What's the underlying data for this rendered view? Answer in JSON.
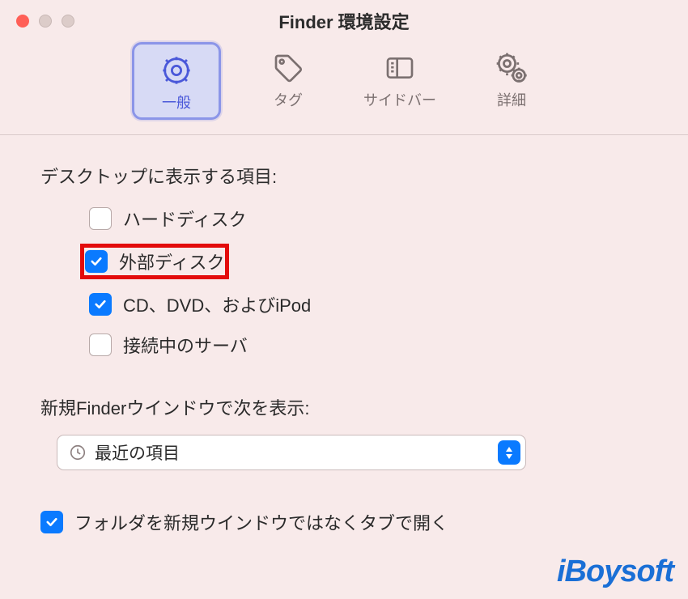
{
  "window": {
    "title": "Finder 環境設定"
  },
  "toolbar": {
    "items": [
      {
        "label": "一般",
        "icon": "gear-icon",
        "selected": true
      },
      {
        "label": "タグ",
        "icon": "tag-icon",
        "selected": false
      },
      {
        "label": "サイドバー",
        "icon": "sidebar-icon",
        "selected": false
      },
      {
        "label": "詳細",
        "icon": "gears-icon",
        "selected": false
      }
    ]
  },
  "section_desktop": {
    "heading": "デスクトップに表示する項目:",
    "items": [
      {
        "label": "ハードディスク",
        "checked": false,
        "highlighted": false
      },
      {
        "label": "外部ディスク",
        "checked": true,
        "highlighted": true
      },
      {
        "label": "CD、DVD、およびiPod",
        "checked": true,
        "highlighted": false
      },
      {
        "label": "接続中のサーバ",
        "checked": false,
        "highlighted": false
      }
    ]
  },
  "section_new_window": {
    "heading": "新規Finderウインドウで次を表示:",
    "select_value": "最近の項目"
  },
  "section_tabs": {
    "checkbox_label": "フォルダを新規ウインドウではなくタブで開く",
    "checked": true
  },
  "watermark": "iBoysoft"
}
